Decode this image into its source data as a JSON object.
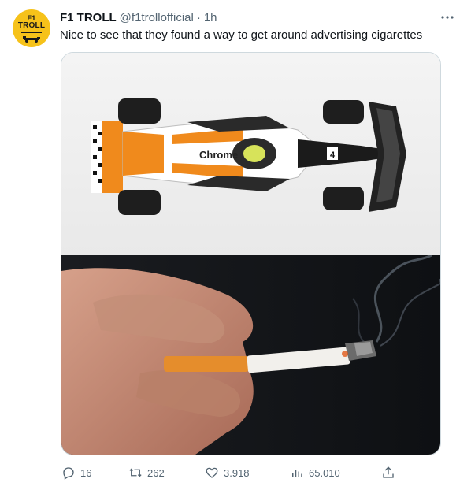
{
  "tweet": {
    "author": {
      "avatar_line1": "F1",
      "avatar_line2": "TROLL",
      "name": "F1 TROLL",
      "handle": "@f1trollofficial",
      "separator": "·",
      "time": "1h"
    },
    "text": "Nice to see that they found a way to get around advertising cigarettes",
    "media": {
      "top_image_label": "Chrome"
    },
    "actions": {
      "replies": "16",
      "retweets": "262",
      "likes": "3.918",
      "views": "65.010"
    }
  },
  "icons": [
    "more-icon",
    "reply-icon",
    "retweet-icon",
    "like-icon",
    "views-icon",
    "share-icon"
  ]
}
